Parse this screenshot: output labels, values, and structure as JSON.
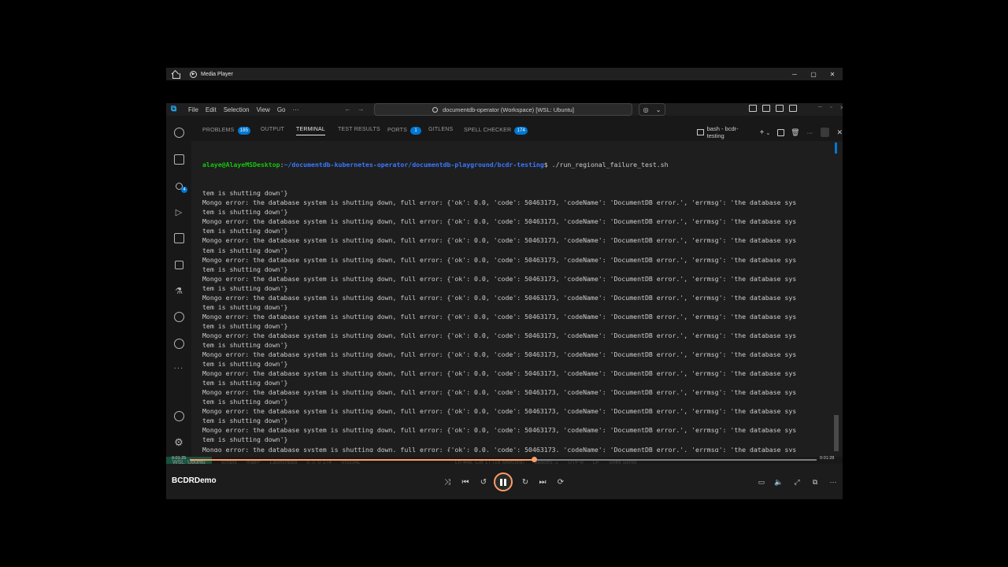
{
  "media_player": {
    "app_name": "Media Player",
    "video_title": "BCDRDemo",
    "time_current": "0:01:25",
    "time_total": "0:01:28",
    "progress_fraction": 0.549,
    "accent": "#ff9e66"
  },
  "vscode": {
    "menu": [
      "File",
      "Edit",
      "Selection",
      "View",
      "Go",
      "···"
    ],
    "search_text": "documentdb-operator (Workspace) [WSL: Ubuntu]",
    "panel_tabs": [
      {
        "label": "PROBLEMS",
        "badge": "185"
      },
      {
        "label": "OUTPUT",
        "badge": ""
      },
      {
        "label": "TERMINAL",
        "badge": ""
      },
      {
        "label": "TEST RESULTS",
        "badge": ""
      },
      {
        "label": "PORTS",
        "badge": "1"
      },
      {
        "label": "GITLENS",
        "badge": ""
      },
      {
        "label": "SPELL CHECKER",
        "badge": "174"
      }
    ],
    "terminal_name": "bash - bcdr-testing",
    "status_remote": "WSL: Ubuntu",
    "status_items": [
      "scripts",
      "main*",
      "Launchpad",
      "0 ⚠ 0 174",
      "VISUAL",
      "Ln 446, Col 17 (16 selected)",
      "Spaces: 2",
      "UTF-8",
      "LF",
      "Shell Script"
    ]
  },
  "terminal": {
    "prompt_user": "alaye@AlayeMSDesktop",
    "prompt_path": "~/documentdb-kubernetes-operator/documentdb-playground/bcdr-testing",
    "prompt_cmd": "$ ./run_regional_failure_test.sh",
    "lines": [
      "tem is shutting down'}",
      "Mongo error: the database system is shutting down, full error: {'ok': 0.0, 'code': 50463173, 'codeName': 'DocumentDB error.', 'errmsg': 'the database sys",
      "tem is shutting down'}",
      "Mongo error: the database system is shutting down, full error: {'ok': 0.0, 'code': 50463173, 'codeName': 'DocumentDB error.', 'errmsg': 'the database sys",
      "tem is shutting down'}",
      "Mongo error: the database system is shutting down, full error: {'ok': 0.0, 'code': 50463173, 'codeName': 'DocumentDB error.', 'errmsg': 'the database sys",
      "tem is shutting down'}",
      "Mongo error: the database system is shutting down, full error: {'ok': 0.0, 'code': 50463173, 'codeName': 'DocumentDB error.', 'errmsg': 'the database sys",
      "tem is shutting down'}",
      "Mongo error: the database system is shutting down, full error: {'ok': 0.0, 'code': 50463173, 'codeName': 'DocumentDB error.', 'errmsg': 'the database sys",
      "tem is shutting down'}",
      "Mongo error: the database system is shutting down, full error: {'ok': 0.0, 'code': 50463173, 'codeName': 'DocumentDB error.', 'errmsg': 'the database sys",
      "tem is shutting down'}",
      "Mongo error: the database system is shutting down, full error: {'ok': 0.0, 'code': 50463173, 'codeName': 'DocumentDB error.', 'errmsg': 'the database sys",
      "tem is shutting down'}",
      "Mongo error: the database system is shutting down, full error: {'ok': 0.0, 'code': 50463173, 'codeName': 'DocumentDB error.', 'errmsg': 'the database sys",
      "tem is shutting down'}",
      "Mongo error: the database system is shutting down, full error: {'ok': 0.0, 'code': 50463173, 'codeName': 'DocumentDB error.', 'errmsg': 'the database sys",
      "tem is shutting down'}",
      "Mongo error: the database system is shutting down, full error: {'ok': 0.0, 'code': 50463173, 'codeName': 'DocumentDB error.', 'errmsg': 'the database sys",
      "tem is shutting down'}",
      "Mongo error: the database system is shutting down, full error: {'ok': 0.0, 'code': 50463173, 'codeName': 'DocumentDB error.', 'errmsg': 'the database sys",
      "tem is shutting down'}",
      "Mongo error: the database system is shutting down, full error: {'ok': 0.0, 'code': 50463173, 'codeName': 'DocumentDB error.', 'errmsg': 'the database sys",
      "tem is shutting down'}",
      "Mongo error: the database system is shutting down, full error: {'ok': 0.0, 'code': 50463173, 'codeName': 'DocumentDB error.', 'errmsg': 'the database sys",
      "tem is shutting down'}",
      "Mongo error: the database system is shutting down, full error: {'ok': 0.0, 'code': 50463173, 'codeName': 'DocumentDB error.', 'errmsg': 'the database sys",
      "tem is shutting down'}"
    ]
  }
}
